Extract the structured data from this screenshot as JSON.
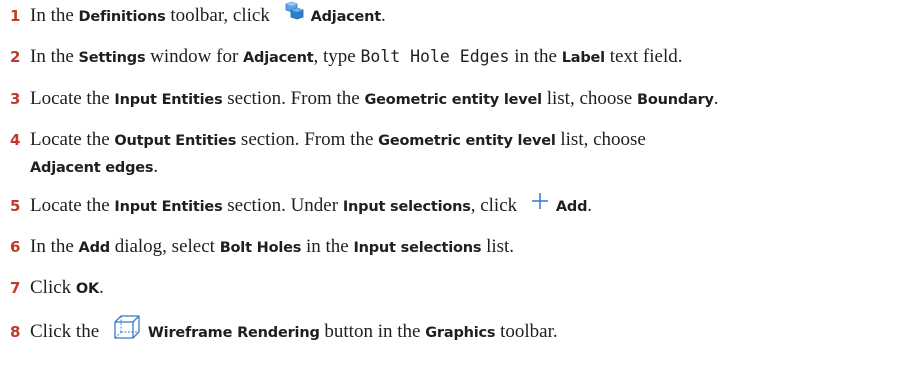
{
  "steps": [
    {
      "number": "1",
      "t1": "In the ",
      "b1": "Definitions",
      "t2": " toolbar, click ",
      "icon": "adjacent-selection-icon",
      "b2": "Adjacent",
      "t3": "."
    },
    {
      "number": "2",
      "t1": "In the ",
      "b1": "Settings",
      "t2": " window for ",
      "b2": "Adjacent",
      "t3": ", type ",
      "code": "Bolt Hole Edges",
      "t4": " in the ",
      "b3": "Label",
      "t5": " text field."
    },
    {
      "number": "3",
      "t1": "Locate the ",
      "b1": "Input Entities",
      "t2": " section. From the ",
      "b2": "Geometric entity level",
      "t3": " list, choose ",
      "b3": "Boundary",
      "t4": "."
    },
    {
      "number": "4",
      "t1": "Locate the ",
      "b1": "Output Entities",
      "t2": " section. From the ",
      "b2": "Geometric entity level",
      "t3": " list, choose",
      "b3": "Adjacent edges",
      "t4": "."
    },
    {
      "number": "5",
      "t1": "Locate the ",
      "b1": "Input Entities",
      "t2": " section. Under ",
      "b2": "Input selections",
      "t3": ", click ",
      "icon": "add-plus-icon",
      "b3": "Add",
      "t4": "."
    },
    {
      "number": "6",
      "t1": "In the ",
      "b1": "Add",
      "t2": " dialog, select ",
      "b2": "Bolt Holes",
      "t3": " in the ",
      "b3": "Input selections",
      "t4": " list."
    },
    {
      "number": "7",
      "t1": "Click ",
      "b1": "OK",
      "t2": "."
    },
    {
      "number": "8",
      "t1": "Click the ",
      "icon": "wireframe-rendering-icon",
      "b1": "Wireframe Rendering",
      "t2": " button in the ",
      "b2": "Graphics",
      "t3": " toolbar."
    }
  ],
  "colors": {
    "step_number": "#c0392b",
    "adjacent_icon_blue": "#2f7fd0",
    "plus_icon_blue": "#3a7ed8",
    "wireframe_icon_blue": "#3a78c8"
  }
}
